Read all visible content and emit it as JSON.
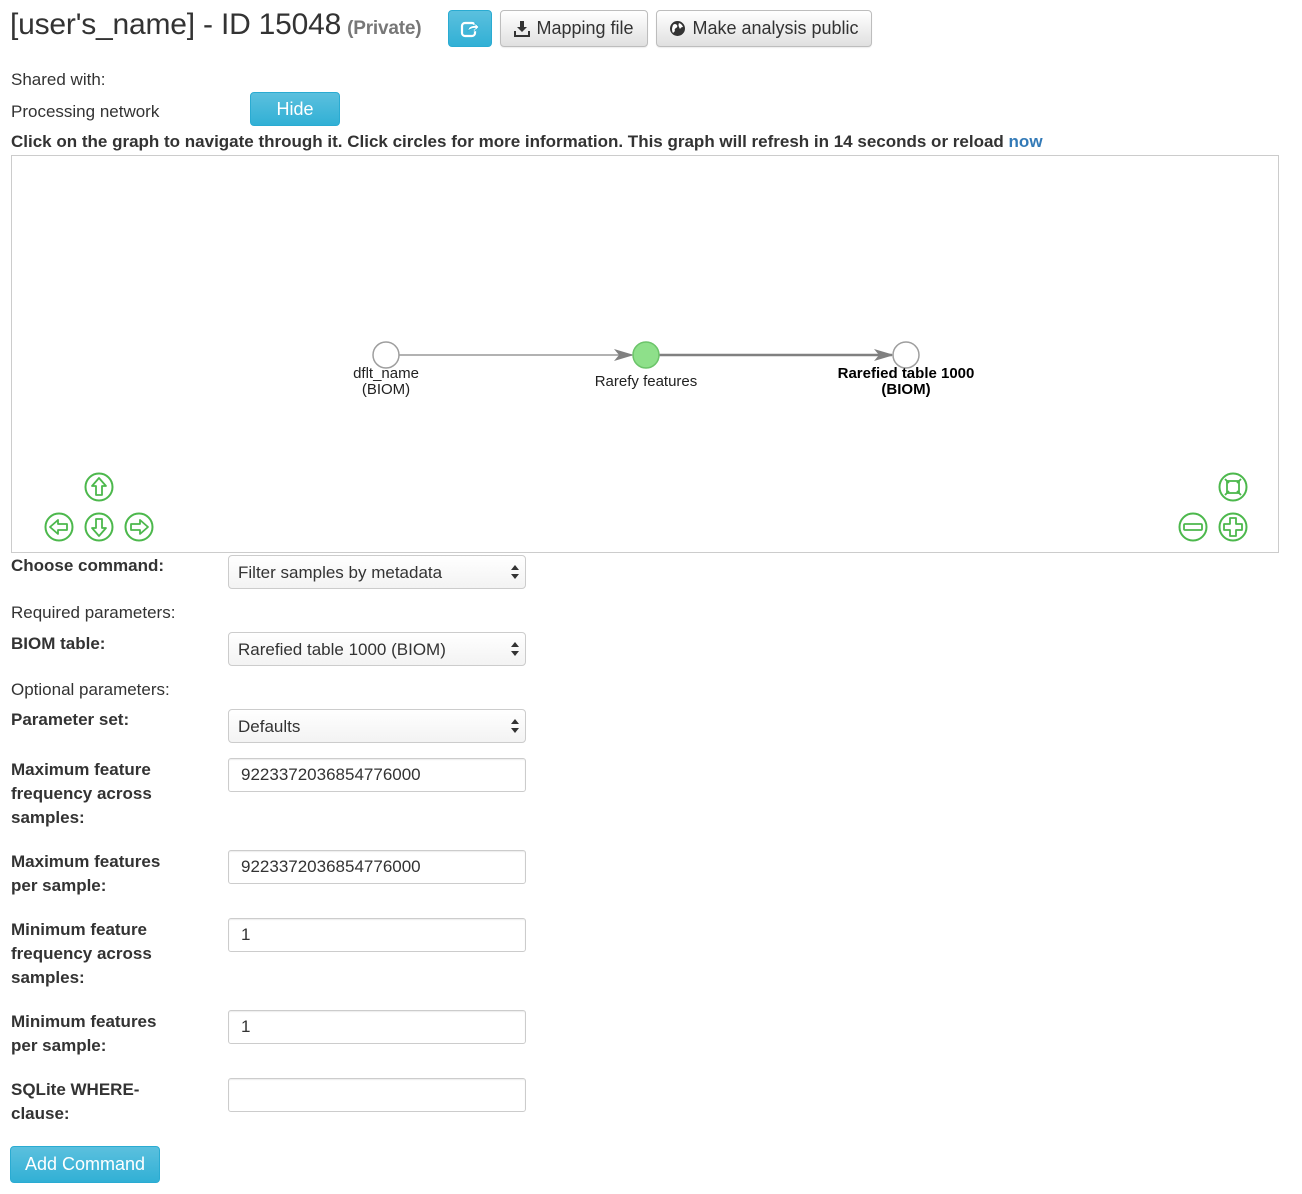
{
  "header": {
    "title": "[user's_name] - ID 15048",
    "privacy": "(Private)",
    "share_icon": "share-icon",
    "mapping_file_label": "Mapping file",
    "make_public_label": "Make analysis public"
  },
  "shared_with_label": "Shared with:",
  "processing_network_label": "Processing network",
  "hide_label": "Hide",
  "instructions": "Click on the graph to navigate through it. Click circles for more information. This graph will refresh in 14 seconds or reload",
  "reload_link": "now",
  "graph": {
    "nodes": [
      {
        "label_line1": "dflt_name",
        "label_line2": "(BIOM)",
        "type": "artifact",
        "color": "#ffffff"
      },
      {
        "label_line1": "Rarefy features",
        "label_line2": "",
        "type": "job",
        "color": "#8ee08a"
      },
      {
        "label_line1": "Rarefied table 1000",
        "label_line2": "(BIOM)",
        "type": "artifact",
        "color": "#ffffff"
      }
    ],
    "nav_icons": [
      "arrow-up-icon",
      "arrow-left-icon",
      "arrow-down-icon",
      "arrow-right-icon",
      "fit-icon",
      "zoom-out-icon",
      "zoom-in-icon"
    ],
    "nav_color": "#4cb84c"
  },
  "form": {
    "choose_command_label": "Choose command:",
    "choose_command_value": "Filter samples by metadata",
    "required_label": "Required parameters:",
    "biom_label": "BIOM table:",
    "biom_value": "Rarefied table 1000 (BIOM)",
    "optional_label": "Optional parameters:",
    "param_set_label": "Parameter set:",
    "param_set_value": "Defaults",
    "params": [
      {
        "line1": "Maximum feature",
        "line2": "frequency across",
        "line3": "samples:",
        "value": "9223372036854776000"
      },
      {
        "line1": "Maximum features",
        "line2": "per sample:",
        "line3": "",
        "value": "9223372036854776000"
      },
      {
        "line1": "Minimum feature",
        "line2": "frequency across",
        "line3": "samples:",
        "value": "1"
      },
      {
        "line1": "Minimum features",
        "line2": "per sample:",
        "line3": "",
        "value": "1"
      },
      {
        "line1": "SQLite WHERE-",
        "line2": "clause:",
        "line3": "",
        "value": ""
      }
    ],
    "add_command_label": "Add Command"
  },
  "colors": {
    "info": "#5bc0de",
    "link": "#337ab7",
    "job_node": "#8ee08a"
  }
}
